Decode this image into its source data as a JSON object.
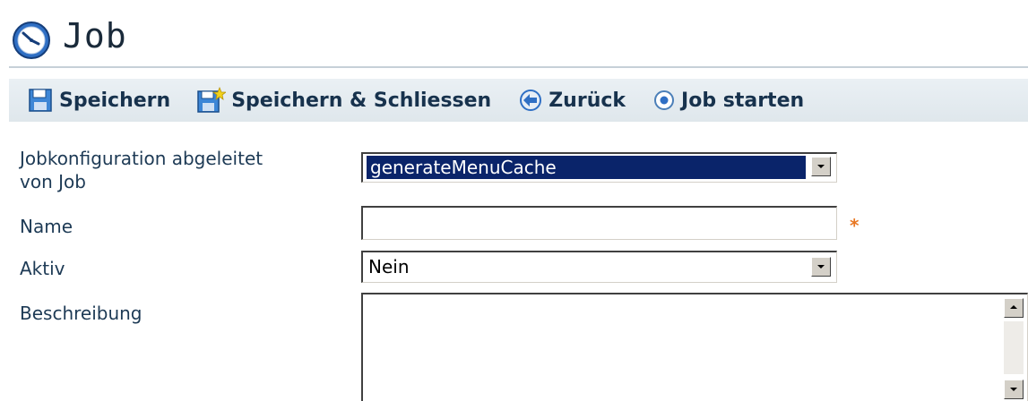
{
  "header": {
    "title": "Job"
  },
  "toolbar": {
    "save_label": "Speichern",
    "save_close_label": "Speichern & Schliessen",
    "back_label": "Zurück",
    "start_label": "Job starten"
  },
  "form": {
    "config_label_line1": "Jobkonfiguration abgeleitet",
    "config_label_line2": "von Job",
    "config_value": "generateMenuCache",
    "name_label": "Name",
    "name_value": "",
    "required_marker": "*",
    "active_label": "Aktiv",
    "active_value": "Nein",
    "description_label": "Beschreibung",
    "description_value": ""
  },
  "colors": {
    "toolbar_bg": "#dfe7ec",
    "label_text": "#1d3a55",
    "selected_bg": "#0a246a",
    "required": "#e87722"
  }
}
